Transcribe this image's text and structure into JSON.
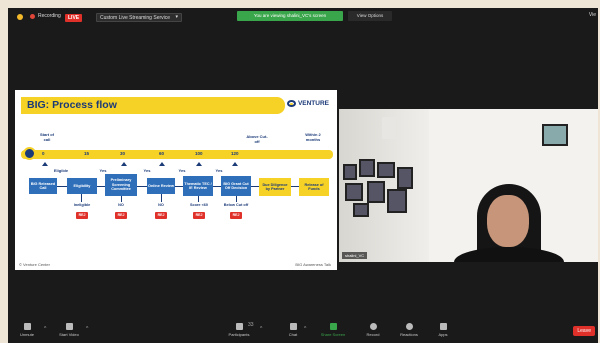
{
  "topbar": {
    "recording": "Recording",
    "live": "LIVE",
    "stream_service": "Custom Live Streaming Service",
    "share_notice": "You are viewing shalini_VC's screen",
    "view_options": "View Options",
    "view_right": "Vie"
  },
  "slide": {
    "title": "BIG: Process flow",
    "logo": "VENTURE",
    "start_label": "Start of call",
    "above_cutoff": "Above Cut-off",
    "within": "Within 2 months",
    "ticks": [
      "0",
      "15",
      "30",
      "60",
      "100",
      "120"
    ],
    "eligible": "Eligible",
    "yes_labels": [
      "Yes",
      "Yes",
      "Yes",
      "Yes"
    ],
    "boxes": [
      "BIG Released Call",
      "Eligibility",
      "Preliminary Screening Committee",
      "Online Review",
      "Thematic TEC / IE Review",
      "BIG Grant Cut Off Decision",
      "Due Diligence by Partner",
      "Release of Funds"
    ],
    "down_labels": [
      "Ineligible",
      "NO",
      "NO",
      "Score <60",
      "Below Cut off"
    ],
    "reject": "REJ",
    "footer_left": "© Venture Center",
    "footer_right": "BIG Awareness Talk"
  },
  "video": {
    "name": "shalini_VC"
  },
  "toolbar": {
    "items": [
      "Unmute",
      "Start Video",
      "Participants",
      "Chat",
      "Share Screen",
      "Record",
      "Reactions",
      "Apps"
    ],
    "participants_count": "33",
    "leave": "Leave"
  },
  "colors": {
    "accent_green": "#3aa64b",
    "live_red": "#e0302a",
    "slide_yellow": "#f6d126",
    "slide_blue": "#2f6fba"
  }
}
